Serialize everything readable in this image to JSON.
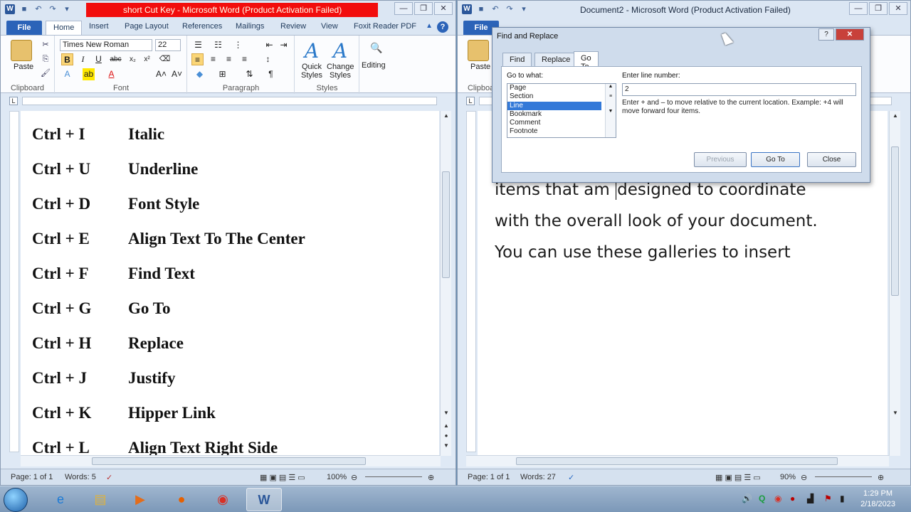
{
  "left_window": {
    "title": "short Cut Key  -  Microsoft Word (Product Activation Failed)",
    "tabs": [
      "File",
      "Home",
      "Insert",
      "Page Layout",
      "References",
      "Mailings",
      "Review",
      "View",
      "Foxit Reader PDF"
    ],
    "ribbon": {
      "paste_label": "Paste",
      "clipboard_label": "Clipboard",
      "font_name": "Times New Roman",
      "font_size": "22",
      "font_label": "Font",
      "paragraph_label": "Paragraph",
      "quick_styles_label": "Quick Styles",
      "change_styles_label": "Change Styles",
      "styles_label": "Styles",
      "editing_label": "Editing"
    },
    "shortcuts": [
      {
        "key": "Ctrl + I",
        "desc": "Italic"
      },
      {
        "key": "Ctrl + U",
        "desc": "Underline"
      },
      {
        "key": "Ctrl + D",
        "desc": "Font Style"
      },
      {
        "key": "Ctrl + E",
        "desc": "Align Text To The Center"
      },
      {
        "key": "Ctrl + F",
        "desc": "Find Text"
      },
      {
        "key": "Ctrl + G",
        "desc": "Go To"
      },
      {
        "key": "Ctrl + H",
        "desc": "Replace"
      },
      {
        "key": "Ctrl + J",
        "desc": "Justify"
      },
      {
        "key": "Ctrl + K",
        "desc": "Hipper Link"
      },
      {
        "key": "Ctrl + L",
        "desc": "Align Text Right Side"
      }
    ],
    "status": {
      "page": "Page: 1 of 1",
      "words": "Words: 5",
      "zoom": "100%"
    }
  },
  "right_window": {
    "title": "Document2  -  Microsoft Word (Product Activation Failed)",
    "tabs": [
      "File"
    ],
    "ribbon": {
      "paste_label": "Paste",
      "clipboard_label": "Clipboard"
    },
    "body_lines": [
      "items that am ",
      "designed to coordinate",
      "with the overall look of your document.",
      "You can use these galleries to insert"
    ],
    "status": {
      "page": "Page: 1 of 1",
      "words": "Words: 27",
      "zoom": "90%"
    }
  },
  "dialog": {
    "title": "Find and Replace",
    "tabs": [
      "Find",
      "Replace",
      "Go To"
    ],
    "go_to_what_label": "Go to what:",
    "go_to_items": [
      "Page",
      "Section",
      "Line",
      "Bookmark",
      "Comment",
      "Footnote"
    ],
    "selected_item": "Line",
    "enter_label": "Enter line number:",
    "line_value": "2",
    "hint": "Enter + and – to move relative to the current location. Example: +4 will move forward four items.",
    "btn_previous": "Previous",
    "btn_goto": "Go To",
    "btn_close": "Close",
    "help_glyph": "?",
    "close_glyph": "✕"
  },
  "taskbar": {
    "icons": [
      "start-orb",
      "internet-explorer-icon",
      "file-explorer-icon",
      "media-player-icon",
      "firefox-icon",
      "chrome-icon",
      "word-icon"
    ],
    "time": "1:29 PM",
    "date": "2/18/2023"
  },
  "colors": {
    "title_alert": "#f20d0d",
    "file_tab": "#2b63b8",
    "selection": "#3379d8"
  }
}
